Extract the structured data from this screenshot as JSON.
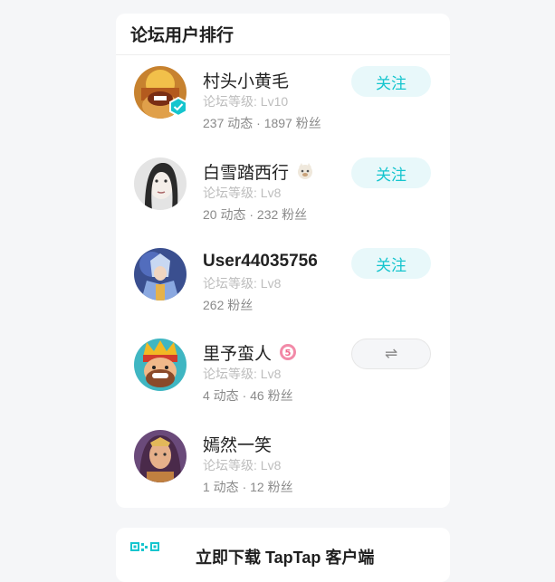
{
  "ranking": {
    "title": "论坛用户排行",
    "users": [
      {
        "name": "村头小黄毛",
        "level": "论坛等级: Lv10",
        "stats": "237 动态 · 1897 粉丝",
        "button": "关注",
        "avatar_icon": "clash-barbarian-avatar",
        "verified": true
      },
      {
        "name": "白雪踏西行",
        "level": "论坛等级: Lv8",
        "stats": "20 动态 · 232 粉丝",
        "button": "关注",
        "avatar_icon": "woman-portrait-avatar",
        "badge_icon": "cat-badge-icon"
      },
      {
        "name": "User44035756",
        "level": "论坛等级: Lv8",
        "stats": "262 粉丝",
        "button": "关注",
        "avatar_icon": "armored-hero-avatar"
      },
      {
        "name": "里予蛮人",
        "level": "论坛等级: Lv8",
        "stats": "4 动态 · 46 粉丝",
        "button": "⇌",
        "avatar_icon": "clash-royale-king-avatar",
        "badge_icon": "level-5-badge-icon"
      },
      {
        "name": "嫣然一笑",
        "level": "论坛等级: Lv8",
        "stats": "1 动态 · 12 粉丝",
        "avatar_icon": "fantasy-heroine-avatar"
      }
    ]
  },
  "download": {
    "title": "立即下载 TapTap 客户端",
    "icon": "qr-code-icon"
  },
  "colors": {
    "accent": "#15c5ce",
    "follow_bg": "#e8f8fa",
    "background": "#f5f6f8"
  }
}
